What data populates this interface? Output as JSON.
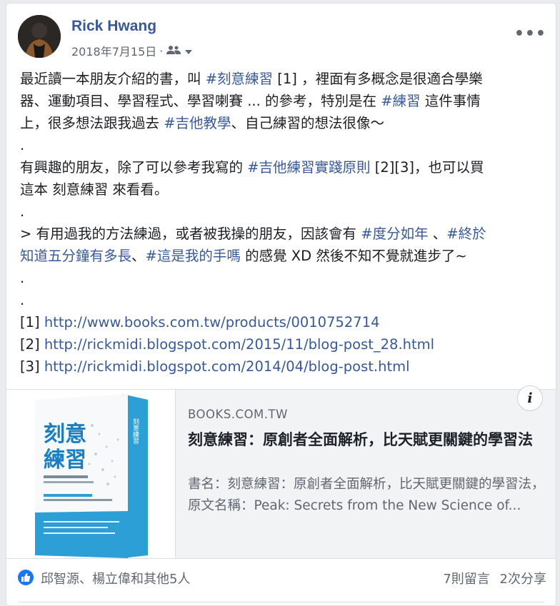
{
  "post": {
    "author": "Rick Hwang",
    "date": "2018年7月15日",
    "date_separator": "·",
    "paragraphs": [
      [
        {
          "t": "最近讀一本朋友介紹的書，叫 "
        },
        {
          "t": "#刻意練習",
          "c": "tag"
        },
        {
          "t": " [1] ，裡面有多概念是很適合學樂"
        }
      ],
      [
        {
          "t": "器、運動項目、學習程式、學習喇賽 ... 的參考，特別是在 "
        },
        {
          "t": "#練習",
          "c": "tag"
        },
        {
          "t": " 這件事情"
        }
      ],
      [
        {
          "t": "上，很多想法跟我過去 "
        },
        {
          "t": "#吉他教學",
          "c": "tag"
        },
        {
          "t": "、自己練習的想法很像～"
        }
      ],
      [
        {
          "t": "."
        }
      ],
      [
        {
          "t": "有興趣的朋友，除了可以參考我寫的 "
        },
        {
          "t": "#吉他練習實踐原則",
          "c": "tag"
        },
        {
          "t": " [2][3]，也可以買"
        }
      ],
      [
        {
          "t": "這本 刻意練習 來看看。"
        }
      ],
      [
        {
          "t": "."
        }
      ],
      [
        {
          "t": "> 有用過我的方法練過，或者被我操的朋友，因該會有 "
        },
        {
          "t": "#度分如年",
          "c": "tag"
        },
        {
          "t": " 、"
        },
        {
          "t": "#終於",
          "c": "tag"
        }
      ],
      [
        {
          "t": "知道五分鐘有多長",
          "c": "tag"
        },
        {
          "t": "、"
        },
        {
          "t": "#這是我的手嗎",
          "c": "tag"
        },
        {
          "t": " 的感覺 XD 然後不知不覺就進步了~"
        }
      ],
      [
        {
          "t": "."
        }
      ],
      [
        {
          "t": "."
        }
      ],
      [
        {
          "t": "[1] "
        },
        {
          "t": "http://www.books.com.tw/products/0010752714",
          "c": "link"
        }
      ],
      [
        {
          "t": "[2] "
        },
        {
          "t": "http://rickmidi.blogspot.com/2015/11/blog-post_28.html",
          "c": "link"
        }
      ],
      [
        {
          "t": "[3] "
        },
        {
          "t": "http://rickmidi.blogspot.com/2014/04/blog-post.html",
          "c": "link"
        }
      ]
    ]
  },
  "preview": {
    "domain": "BOOKS.COM.TW",
    "title": "刻意練習：原創者全面解析，比天賦更關鍵的學習法",
    "description": "書名：刻意練習：原創者全面解析，比天賦更關鍵的學習法，原文名稱：Peak: Secrets from the New Science of...",
    "info_icon": "i",
    "cover": {
      "title_line1": "刻意",
      "title_line2": "練習",
      "spine_title": "刻意練習",
      "colors": {
        "title": "#1a7fc1",
        "band": "#2b9fd6",
        "spine": "#2b9fd6"
      }
    }
  },
  "footer": {
    "likes": "邱智源、楊立偉和其他5人",
    "comments": "7則留言",
    "shares": "2次分享"
  },
  "colors": {
    "link": "#385898",
    "meta": "#606770",
    "like": "#1877f2"
  }
}
